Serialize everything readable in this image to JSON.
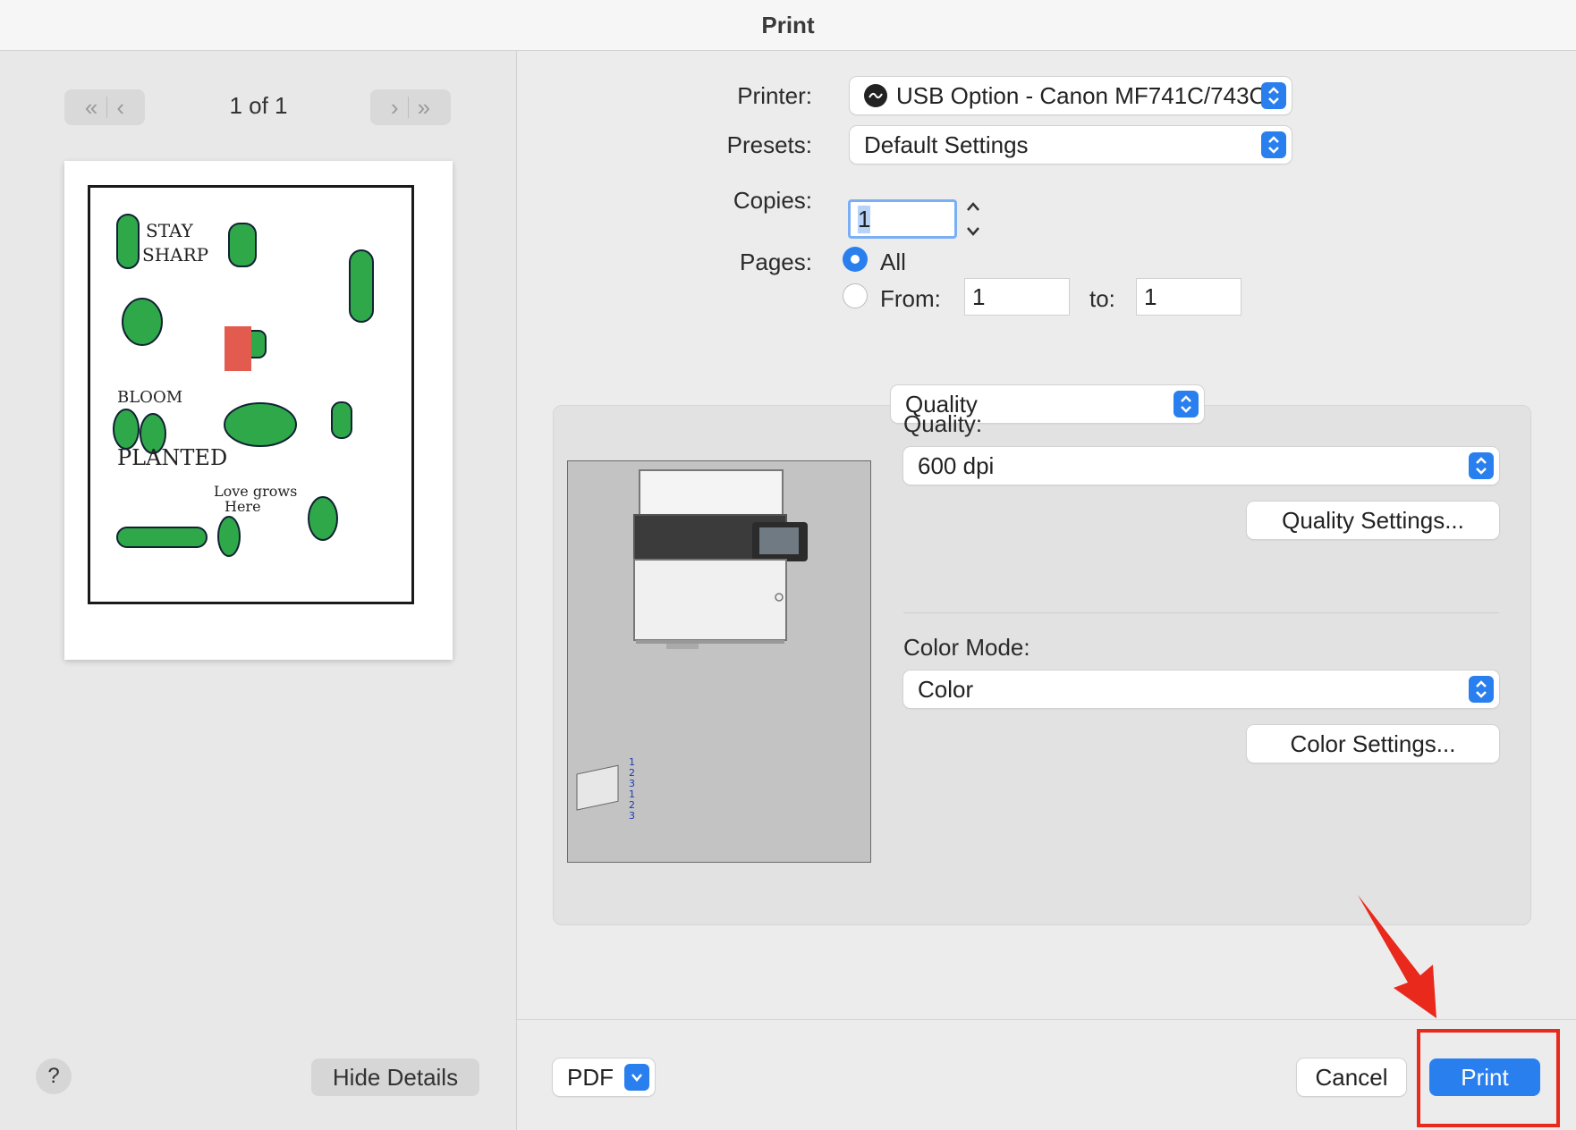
{
  "window": {
    "title": "Print"
  },
  "preview": {
    "page_count": "1 of 1",
    "nav_first": "«",
    "nav_prev": "‹",
    "nav_next": "›",
    "nav_last": "»"
  },
  "footer_left": {
    "help": "?",
    "hide_details": "Hide Details"
  },
  "form": {
    "printer_label": "Printer:",
    "printer_value": "USB Option - Canon MF741C/743C U...",
    "presets_label": "Presets:",
    "presets_value": "Default Settings",
    "copies_label": "Copies:",
    "copies_value": "1",
    "pages_label": "Pages:",
    "pages_all": "All",
    "pages_from_label": "From:",
    "pages_from_value": "1",
    "pages_to_label": "to:",
    "pages_to_value": "1"
  },
  "panel": {
    "section_select": "Quality",
    "quality_label": "Quality:",
    "quality_value": "600 dpi",
    "quality_settings_button": "Quality Settings...",
    "color_mode_label": "Color Mode:",
    "color_mode_value": "Color",
    "color_settings_button": "Color Settings..."
  },
  "footer": {
    "pdf": "PDF",
    "cancel": "Cancel",
    "print": "Print"
  },
  "colors": {
    "accent": "#2a7fef",
    "highlight": "#e8291c"
  },
  "icons": [
    "printer-status-icon",
    "popup-chevron-icon",
    "stepper-up-icon",
    "stepper-down-icon",
    "help-icon",
    "pdf-chevron-icon",
    "red-arrow-annotation-icon"
  ]
}
